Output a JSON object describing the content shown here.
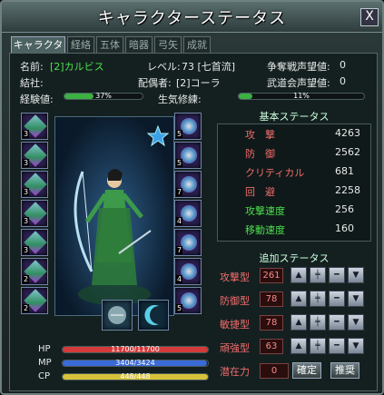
{
  "window": {
    "title": "キャラクターステータス",
    "close_label": "X"
  },
  "tabs": [
    {
      "label": "キャラクター"
    },
    {
      "label": "経絡"
    },
    {
      "label": "五体"
    },
    {
      "label": "暗器"
    },
    {
      "label": "弓矢"
    },
    {
      "label": "成就"
    }
  ],
  "info": {
    "name_label": "名前:",
    "name_value": "[2]カルビス",
    "level_label": "レベル:",
    "level_value": "73 [七首流]",
    "war_label": "争奪戦声望値:",
    "war_value": "0",
    "guild_label": "結社:",
    "guild_value": "",
    "spouse_label": "配偶者:",
    "spouse_value": "[2]コーラ",
    "tournament_label": "武道会声望値:",
    "tournament_value": "0",
    "exp_label": "経験値:",
    "exp_text": "37%",
    "exp_fraction": 0.37,
    "life_label": "生気修練:",
    "life_text": "11%",
    "life_fraction": 0.11
  },
  "equipment": {
    "left_slots": [
      {
        "count": "3"
      },
      {
        "count": "3"
      },
      {
        "count": "3"
      },
      {
        "count": "3"
      },
      {
        "count": "3"
      },
      {
        "count": "2"
      },
      {
        "count": "2"
      }
    ],
    "right_slots": [
      {
        "count": "5"
      },
      {
        "count": "5"
      },
      {
        "count": "7"
      },
      {
        "count": "4"
      },
      {
        "count": "7"
      },
      {
        "count": "4"
      },
      {
        "count": "5"
      }
    ],
    "bottom_slots": [
      {
        "count": ""
      },
      {
        "count": ""
      }
    ]
  },
  "basic_stats": {
    "header": "基本ステータス",
    "rows": [
      {
        "name": "攻　撃",
        "value": "4263",
        "color": "#f36c6c"
      },
      {
        "name": "防　御",
        "value": "2562",
        "color": "#f36c6c"
      },
      {
        "name": "クリティカル",
        "value": "681",
        "color": "#f36c6c"
      },
      {
        "name": "回　避",
        "value": "2258",
        "color": "#f36c6c"
      },
      {
        "name": "攻撃速度",
        "value": "256",
        "color": "#4de04d"
      },
      {
        "name": "移動速度",
        "value": "160",
        "color": "#4de04d"
      }
    ]
  },
  "extra_stats": {
    "header": "追加ステータス",
    "rows": [
      {
        "name": "攻撃型",
        "value": "261"
      },
      {
        "name": "防御型",
        "value": "78"
      },
      {
        "name": "敏捷型",
        "value": "78"
      },
      {
        "name": "頑強型",
        "value": "63"
      }
    ],
    "potential_label": "潜在力",
    "potential_value": "0",
    "confirm_label": "確定",
    "recommend_label": "推奨"
  },
  "resources": [
    {
      "label": "HP",
      "text": "11700/11700",
      "fraction": 1.0,
      "color": "#d43a3a"
    },
    {
      "label": "MP",
      "text": "3404/3424",
      "fraction": 0.994,
      "color": "#3a6ad8"
    },
    {
      "label": "CP",
      "text": "448/448",
      "fraction": 1.0,
      "color": "#d8c23a"
    }
  ],
  "colors": {
    "accent_red": "#f36c6c",
    "accent_green": "#4de04d"
  }
}
